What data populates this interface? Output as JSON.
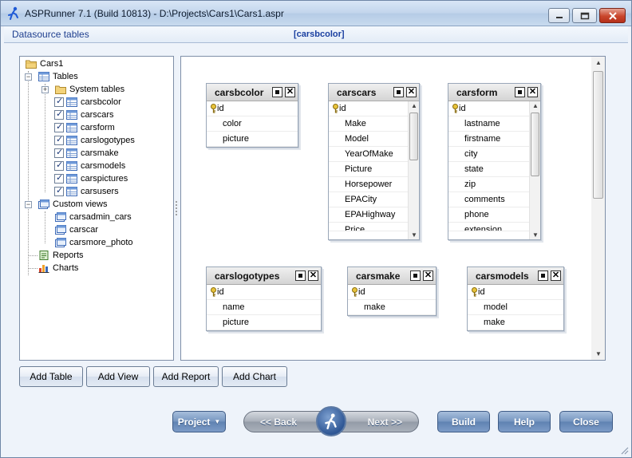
{
  "window": {
    "title": "ASPRunner 7.1 (Build 10813) - D:\\Projects\\Cars1\\Cars1.aspr"
  },
  "header": {
    "left_label": "Datasource tables",
    "center_label": "[carsbcolor]"
  },
  "tree": {
    "root": "Cars1",
    "tables_label": "Tables",
    "system_tables_label": "System tables",
    "tables": [
      "carsbcolor",
      "carscars",
      "carsform",
      "carslogotypes",
      "carsmake",
      "carsmodels",
      "carspictures",
      "carsusers"
    ],
    "custom_views_label": "Custom views",
    "custom_views": [
      "carsadmin_cars",
      "carscar",
      "carsmore_photo"
    ],
    "reports_label": "Reports",
    "charts_label": "Charts"
  },
  "canvas_tables": [
    {
      "name": "carsbcolor",
      "fields": [
        "id",
        "color",
        "picture"
      ],
      "scroll": false
    },
    {
      "name": "carscars",
      "fields": [
        "id",
        "Make",
        "Model",
        "YearOfMake",
        "Picture",
        "Horsepower",
        "EPACity",
        "EPAHighway",
        "Price"
      ],
      "scroll": true
    },
    {
      "name": "carsform",
      "fields": [
        "id",
        "lastname",
        "firstname",
        "city",
        "state",
        "zip",
        "comments",
        "phone",
        "extension"
      ],
      "scroll": true
    },
    {
      "name": "carslogotypes",
      "fields": [
        "id",
        "name",
        "picture"
      ],
      "scroll": false
    },
    {
      "name": "carsmake",
      "fields": [
        "id",
        "make"
      ],
      "scroll": false
    },
    {
      "name": "carsmodels",
      "fields": [
        "id",
        "model",
        "make"
      ],
      "scroll": false
    }
  ],
  "actions": {
    "add_table": "Add Table",
    "add_view": "Add View",
    "add_report": "Add Report",
    "add_chart": "Add Chart"
  },
  "nav": {
    "project": "Project",
    "back": "<< Back",
    "next": "Next >>",
    "build": "Build",
    "help": "Help",
    "close": "Close"
  },
  "icons": {
    "app": "runner-icon",
    "table": "table-icon",
    "view": "view-icon",
    "folder": "folder-icon",
    "report": "report-icon",
    "chart": "chart-icon",
    "key": "key-icon"
  },
  "colors": {
    "accent": "#1a3fa0",
    "nav_button": "#6f8fbd",
    "close_button": "#c9462c"
  }
}
